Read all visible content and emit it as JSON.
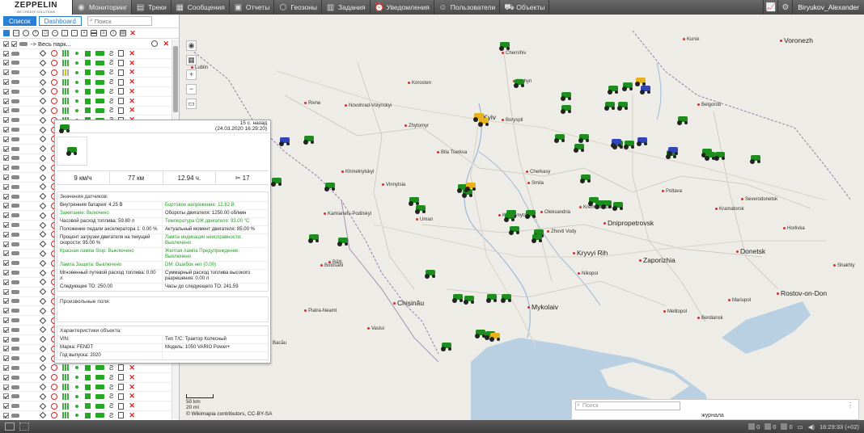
{
  "logo": {
    "name": "ZEPPELIN",
    "tagline": "WE CREATE SOLUTIONS"
  },
  "nav": [
    {
      "label": "Мониторинг",
      "icon": "monitoring-icon",
      "active": true
    },
    {
      "label": "Треки",
      "icon": "tracks-icon"
    },
    {
      "label": "Сообщения",
      "icon": "messages-icon"
    },
    {
      "label": "Отчеты",
      "icon": "reports-icon"
    },
    {
      "label": "Геозоны",
      "icon": "geofence-icon"
    },
    {
      "label": "Задания",
      "icon": "tasks-icon"
    },
    {
      "label": "Уведомления",
      "icon": "notifications-icon"
    },
    {
      "label": "Пользователи",
      "icon": "users-icon"
    },
    {
      "label": "Объекты",
      "icon": "objects-icon"
    }
  ],
  "user": {
    "name": "Biryukov_Alexander"
  },
  "left": {
    "tab_list": "Список",
    "tab_dashboard": "Dashboard",
    "search_placeholder": "Поиск",
    "group_label": "-> Весь парк..."
  },
  "popup": {
    "ago": "15 с. назад",
    "datetime": "(24.03.2020 16:29:20)",
    "speed": "9 км/ч",
    "distance": "77 км",
    "hours": "12.94 ч.",
    "sats": "17",
    "sensors_title": "Значения датчиков:",
    "sensors": [
      {
        "text": "Внутренняя батарея: 4.25 В",
        "green": false
      },
      {
        "text": "Бортовое напряжение: 12.82 В",
        "green": true
      },
      {
        "text": "Зажигание: Включено",
        "green": true
      },
      {
        "text": "Обороты двигателя: 1250.00 об/мин",
        "green": false
      },
      {
        "text": "Часовой расход топлива: 59.80 л",
        "green": false
      },
      {
        "text": "Температура ОЖ двигателя: 93.00 °C",
        "green": true
      },
      {
        "text": "Положение педали акселератора 1: 0.00 %",
        "green": false
      },
      {
        "text": "Актуальный момент двигателя: 85.00 %",
        "green": false
      },
      {
        "text": "Процент загрузки двигателя на текущей скорости: 95.00 %",
        "green": false
      },
      {
        "text": "Лампа индикации неисправности: Выключено",
        "green": true
      },
      {
        "text": "Красная лампа Stop: Выключено",
        "green": true
      },
      {
        "text": "Желтая лампа Предупреждение: Выключено",
        "green": true
      },
      {
        "text": "Лампа Защита: Выключено",
        "green": true
      },
      {
        "text": "DM: Ошибок нет (0.00)",
        "green": true
      },
      {
        "text": "Мгновенный путевой расход топлива: 0.00 л",
        "green": false
      },
      {
        "text": "Суммарный расход топлива высокого разрешения: 0.00 л",
        "green": false
      },
      {
        "text": "Следующее ТО: 250.00",
        "green": false
      },
      {
        "text": "Часы до следующего ТО: 241.59",
        "green": false
      }
    ],
    "custom_title": "Произвольные поля:",
    "chars_title": "Характеристики объекта:",
    "chars": [
      "VIN:",
      "Тип Т/С: Трактор Колесный",
      "Марка: FENDT",
      "Модель: 1050 VARIO Power+",
      "Год выпуска: 2020",
      ""
    ]
  },
  "map": {
    "cities": [
      {
        "n": "Chernihiv",
        "big": false
      },
      {
        "n": "Kyiv",
        "big": true
      },
      {
        "n": "Boryspil",
        "big": false
      },
      {
        "n": "Zhytomyr",
        "big": false
      },
      {
        "n": "Bila Tserkva",
        "big": false
      },
      {
        "n": "Cherkasy",
        "big": false
      },
      {
        "n": "Smila",
        "big": false
      },
      {
        "n": "Vinnytsia",
        "big": false
      },
      {
        "n": "Khmelnytskyi",
        "big": false
      },
      {
        "n": "Kamianets-Podilskyi",
        "big": false
      },
      {
        "n": "Uman",
        "big": false
      },
      {
        "n": "Kropyvnytskyi",
        "big": false
      },
      {
        "n": "Oleksandria",
        "big": false
      },
      {
        "n": "Kremenchuk",
        "big": false
      },
      {
        "n": "Zhovti Vody",
        "big": false
      },
      {
        "n": "Kryvyi Rih",
        "big": true
      },
      {
        "n": "Dnipropetrovsk",
        "big": true
      },
      {
        "n": "Zaporizhia",
        "big": true
      },
      {
        "n": "Donetsk",
        "big": true
      },
      {
        "n": "Mykolaiv",
        "big": true
      },
      {
        "n": "Chișinău",
        "big": true
      },
      {
        "n": "Rostov-on-Don",
        "big": true
      },
      {
        "n": "Voronezh",
        "big": true
      },
      {
        "n": "Belgorod",
        "big": false
      },
      {
        "n": "Kursk",
        "big": false
      },
      {
        "n": "Nikopol",
        "big": false
      },
      {
        "n": "Melitopol",
        "big": false
      },
      {
        "n": "Berdiansk",
        "big": false
      },
      {
        "n": "Mariupol",
        "big": false
      },
      {
        "n": "Horlivka",
        "big": false
      },
      {
        "n": "Kramatorsk",
        "big": false
      },
      {
        "n": "Severodonetsk",
        "big": false
      },
      {
        "n": "Lublin",
        "big": false
      },
      {
        "n": "Rivne",
        "big": false
      },
      {
        "n": "Novohrad-Volynskyi",
        "big": false
      },
      {
        "n": "Korosten",
        "big": false
      },
      {
        "n": "Nizhyn",
        "big": false
      },
      {
        "n": "Bălți",
        "big": false
      },
      {
        "n": "Botosani",
        "big": false
      },
      {
        "n": "Piatra-Neamt",
        "big": false
      },
      {
        "n": "Bacău",
        "big": false
      },
      {
        "n": "Vaslui",
        "big": false
      },
      {
        "n": "Poltava",
        "big": false
      },
      {
        "n": "Shakhty",
        "big": false
      }
    ],
    "scale_km": "50 km",
    "scale_mi": "20 mi",
    "attribution": "© Wikimapia contributors, CC-BY-SA"
  },
  "bottom": {
    "search_placeholder": "Поиск",
    "journal": "журнала"
  },
  "status": {
    "b1": "0",
    "b2": "0",
    "b3": "0",
    "time": "16:29:33 (+02)"
  }
}
